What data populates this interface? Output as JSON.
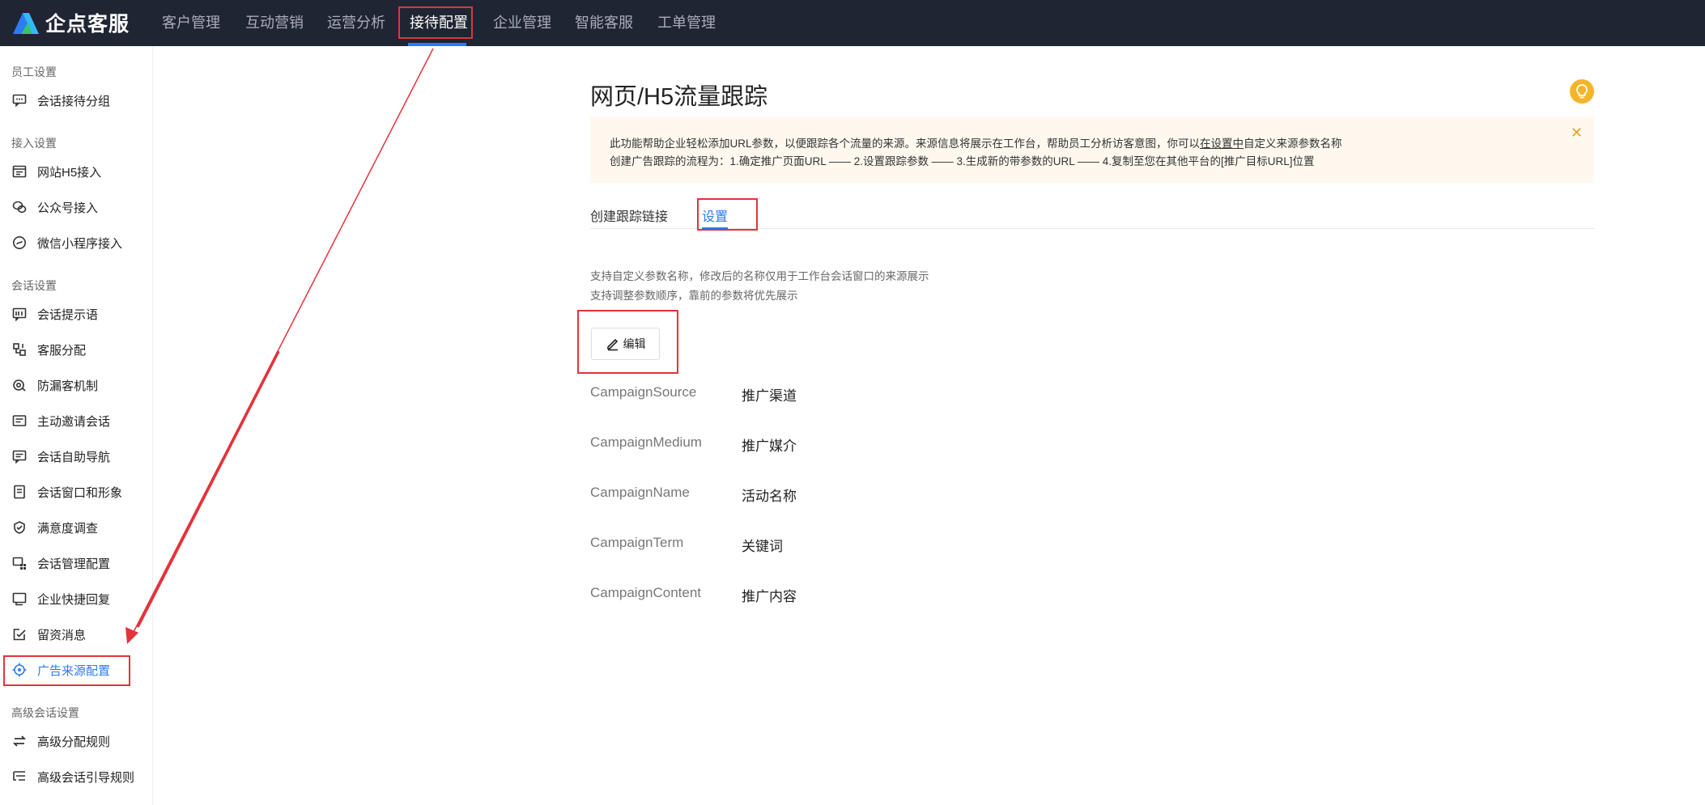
{
  "app": {
    "name": "企点客服"
  },
  "topnav": {
    "items": [
      {
        "label": "客户管理"
      },
      {
        "label": "互动营销"
      },
      {
        "label": "运营分析"
      },
      {
        "label": "接待配置"
      },
      {
        "label": "企业管理"
      },
      {
        "label": "智能客服"
      },
      {
        "label": "工单管理"
      }
    ],
    "active": "接待配置"
  },
  "sidebar": {
    "groups": [
      {
        "title": "员工设置",
        "items": [
          {
            "label": "会话接待分组",
            "icon": "chat-group-icon"
          }
        ]
      },
      {
        "title": "接入设置",
        "items": [
          {
            "label": "网站H5接入",
            "icon": "web-icon"
          },
          {
            "label": "公众号接入",
            "icon": "wechat-icon"
          },
          {
            "label": "微信小程序接入",
            "icon": "miniprogram-icon"
          }
        ]
      },
      {
        "title": "会话设置",
        "items": [
          {
            "label": "会话提示语",
            "icon": "prompt-icon"
          },
          {
            "label": "客服分配",
            "icon": "distribute-icon"
          },
          {
            "label": "防漏客机制",
            "icon": "guard-icon"
          },
          {
            "label": "主动邀请会话",
            "icon": "invite-icon"
          },
          {
            "label": "会话自助导航",
            "icon": "navigation-icon"
          },
          {
            "label": "会话窗口和形象",
            "icon": "window-icon"
          },
          {
            "label": "满意度调查",
            "icon": "survey-icon"
          },
          {
            "label": "会话管理配置",
            "icon": "config-icon"
          },
          {
            "label": "企业快捷回复",
            "icon": "quick-reply-icon"
          },
          {
            "label": "留资消息",
            "icon": "message-icon"
          },
          {
            "label": "广告来源配置",
            "icon": "target-icon"
          }
        ]
      },
      {
        "title": "高级会话设置",
        "items": [
          {
            "label": "高级分配规则",
            "icon": "swap-icon"
          },
          {
            "label": "高级会话引导规则",
            "icon": "guide-icon"
          }
        ]
      }
    ],
    "active": "广告来源配置"
  },
  "main": {
    "title": "网页/H5流量跟踪",
    "notice": {
      "line1_prefix": "此功能帮助企业轻松添加URL参数，以便跟踪各个流量的来源。来源信息将展示在工作台，帮助员工分析访客意图，你可以",
      "line1_link": "在设置中",
      "line1_suffix": "自定义来源参数名称",
      "line2": "创建广告跟踪的流程为：1.确定推广页面URL —— 2.设置跟踪参数 —— 3.生成新的带参数的URL —— 4.复制至您在其他平台的[推广目标URL]位置"
    },
    "tabs": [
      {
        "label": "创建跟踪链接"
      },
      {
        "label": "设置"
      }
    ],
    "active_tab": "设置",
    "desc1": "支持自定义参数名称，修改后的名称仅用于工作台会话窗口的来源展示",
    "desc2": "支持调整参数顺序，靠前的参数将优先展示",
    "edit_label": "编辑",
    "params": [
      {
        "key": "CampaignSource",
        "value": "推广渠道"
      },
      {
        "key": "CampaignMedium",
        "value": "推广媒介"
      },
      {
        "key": "CampaignName",
        "value": "活动名称"
      },
      {
        "key": "CampaignTerm",
        "value": "关键词"
      },
      {
        "key": "CampaignContent",
        "value": "推广内容"
      }
    ]
  },
  "colors": {
    "accent": "#2b7cf6",
    "topbar": "#1f2533",
    "annotation": "#e5323b",
    "notice_bg": "#fef8ee",
    "tip": "#f5b52a"
  }
}
